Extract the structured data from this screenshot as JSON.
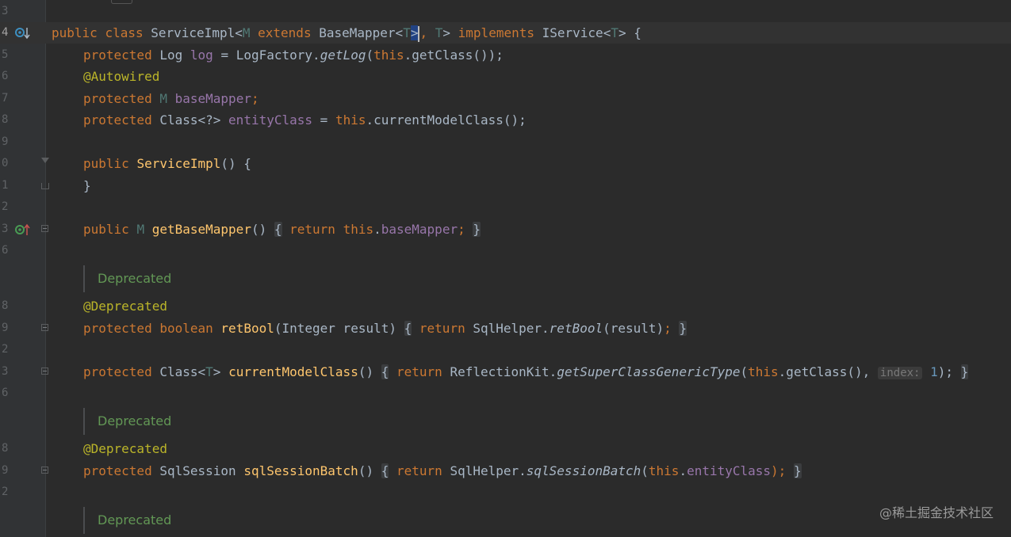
{
  "editor": {
    "line_numbers": [
      "3",
      "4",
      "5",
      "6",
      "7",
      "8",
      "9",
      "0",
      "1",
      "2",
      "3",
      "6",
      "8",
      "9",
      "2",
      "3",
      "6",
      "8",
      "9",
      "2"
    ],
    "lines": {
      "l4": {
        "public": "public",
        "class": "class",
        "name": "ServiceImpl",
        "lt": "<",
        "M": "M",
        "extends": "extends",
        "BaseMapper": "BaseMapper",
        "lt2": "<",
        "T": "T",
        ">": ">",
        ",": ",",
        "T2": " T",
        "gt2": ">",
        "implements": "implements",
        "IService": "IService",
        "lt3": "<",
        "T3": "T",
        "gt3": ">",
        "brace": "{"
      },
      "l5": {
        "protected": "protected",
        "Log": "Log",
        "log": "log",
        "eq": "=",
        "LogFactory": "LogFactory.",
        "getLog": "getLog",
        "paren": "(",
        "this": "this",
        ".getClass": ".getClass());"
      },
      "l6": {
        "anno": "@Autowired"
      },
      "l7": {
        "protected": "protected",
        "M": "M",
        "baseMapper": "baseMapper",
        "semi": ";"
      },
      "l8": {
        "protected": "protected",
        "Class": "Class<?>",
        "entityClass": "entityClass",
        "eq": "=",
        "this": "this",
        ".current": ".currentModelClass();"
      },
      "l10": {
        "public": "public",
        "ServiceImpl": "ServiceImpl",
        "rest": "() {"
      },
      "l11": {
        "brace": "}"
      },
      "l13": {
        "public": "public",
        "M": "M",
        "getBaseMapper": "getBaseMapper",
        "paren": "()",
        "ob": "{",
        "return": "return",
        "this": "this",
        "dot": ".",
        "baseMapper": "baseMapper",
        "semi": ";",
        "cb": "}"
      },
      "doc1": "Deprecated",
      "l18": {
        "anno": "@Deprecated"
      },
      "l19": {
        "protected": "protected",
        "boolean": "boolean",
        "retBool": "retBool",
        "args": "(Integer result)",
        "ob": "{",
        "return": "return",
        "SqlHelper": "SqlHelper.",
        "retBool2": "retBool",
        "args2": "(result)",
        "semi": ";",
        "cb": "}"
      },
      "l23": {
        "protected": "protected",
        "Class": "Class<",
        "T": "T",
        "gt": ">",
        "currentModelClass": "currentModelClass",
        "paren": "()",
        "ob": "{",
        "return": "return",
        "ReflectionKit": "ReflectionKit.",
        "getSuper": "getSuperClassGenericType",
        "open": "(",
        "this": "this",
        ".getClass": ".getClass(),",
        "hint": "index:",
        "one": "1",
        "close": ");",
        "cb": "}"
      },
      "doc2": "Deprecated",
      "l28": {
        "anno": "@Deprecated"
      },
      "l29": {
        "protected": "protected",
        "SqlSession": "SqlSession",
        "sqlSessionBatch": "sqlSessionBatch",
        "paren": "()",
        "ob": "{",
        "return": "return",
        "SqlHelper": "SqlHelper.",
        "sqlSessionBatch2": "sqlSessionBatch",
        "open": "(",
        "this": "this",
        "dot": ".",
        "entityClass": "entityClass",
        "close": ");",
        "cb": "}"
      },
      "doc3": "Deprecated"
    }
  },
  "watermark": "@稀土掘金技术社区",
  "icons": {
    "line4": "implemented-down-icon",
    "line13": "override-up-icon"
  }
}
